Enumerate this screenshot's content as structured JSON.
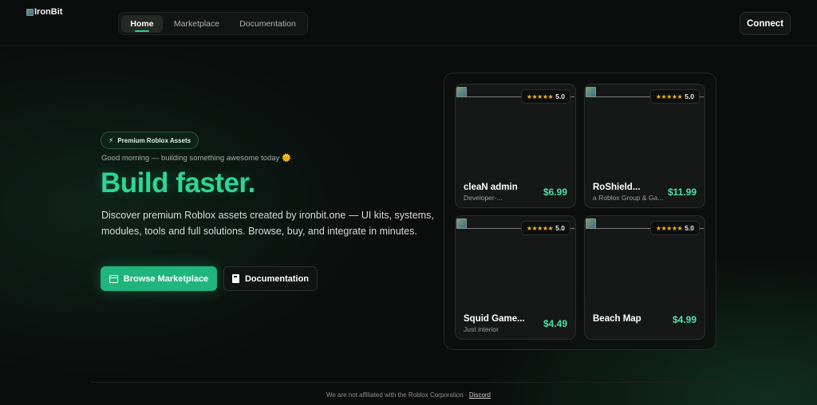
{
  "header": {
    "logo_text": "IronBit",
    "nav": [
      {
        "label": "Home",
        "active": true
      },
      {
        "label": "Marketplace",
        "active": false
      },
      {
        "label": "Documentation",
        "active": false
      }
    ],
    "connect_label": "Connect"
  },
  "hero": {
    "badge_icon": "⚡",
    "badge_label": "Premium Roblox Assets",
    "greeting": "Good morning — building something awesome today 🌞",
    "headline": "Build faster.",
    "subtitle": "Discover premium Roblox assets created by ironbit.one — UI kits, systems, modules, tools and full solutions. Browse, buy, and integrate in minutes.",
    "primary_button": "Browse Marketplace",
    "secondary_button": "Documentation"
  },
  "products": [
    {
      "title": "cleaN admin",
      "subtitle": "Developer-...",
      "price": "$6.99",
      "rating": "5.0",
      "stars": "★★★★★"
    },
    {
      "title": "RoShield...",
      "subtitle": "a Roblox Group & Ga...",
      "price": "$11.99",
      "rating": "5.0",
      "stars": "★★★★★"
    },
    {
      "title": "Squid Game...",
      "subtitle": "Just interior",
      "price": "$4.49",
      "rating": "5.0",
      "stars": "★★★★★"
    },
    {
      "title": "Beach Map",
      "subtitle": "",
      "price": "$4.99",
      "rating": "5.0",
      "stars": "★★★★★"
    }
  ],
  "footer": {
    "text": "We are not affiliated with the Roblox Corporation · ",
    "link": "Discord"
  },
  "colors": {
    "accent": "#2fd594",
    "price": "#4fe0a3",
    "star": "#f5b62b",
    "background": "#0b0d0c"
  }
}
